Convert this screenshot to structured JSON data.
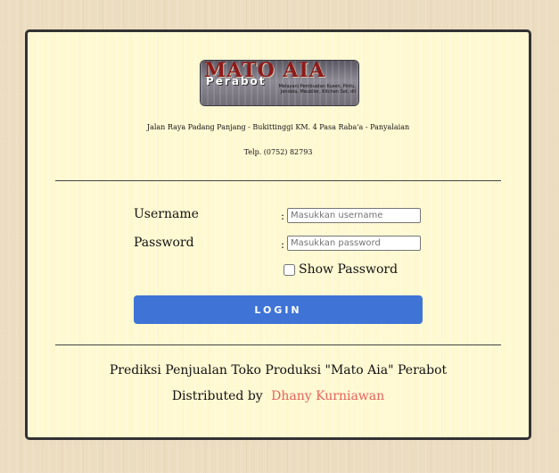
{
  "logo": {
    "title": "MATO AIA",
    "subtitle": "Perabot",
    "description": "Melayani Pembuatan Kusen, Pintu, Jendela, Meubiler, Kitchen Set, dll"
  },
  "header": {
    "address": "Jalan Raya Padang Panjang - Bukittinggi KM. 4 Pasa Raba'a - Panyalaian",
    "phone": "Telp. (0752) 82793"
  },
  "form": {
    "username_label": "Username",
    "username_colon": ":",
    "username_placeholder": "Masukkan username",
    "username_value": "",
    "password_label": "Password",
    "password_colon": ":",
    "password_placeholder": "Masukkan password",
    "password_value": "",
    "show_password_label": "Show Password",
    "show_password_checked": false,
    "login_label": "LOGIN"
  },
  "footer": {
    "title": "Prediksi Penjualan Toko Produksi \"Mato Aia\" Perabot",
    "distributed_prefix": "Distributed by",
    "author": "Dhany Kurniawan"
  },
  "colors": {
    "card_background": "#fff9d2",
    "page_background": "#ecdcc0",
    "button": "#3f74d6",
    "author_link": "#e8625b",
    "border": "#333333"
  }
}
